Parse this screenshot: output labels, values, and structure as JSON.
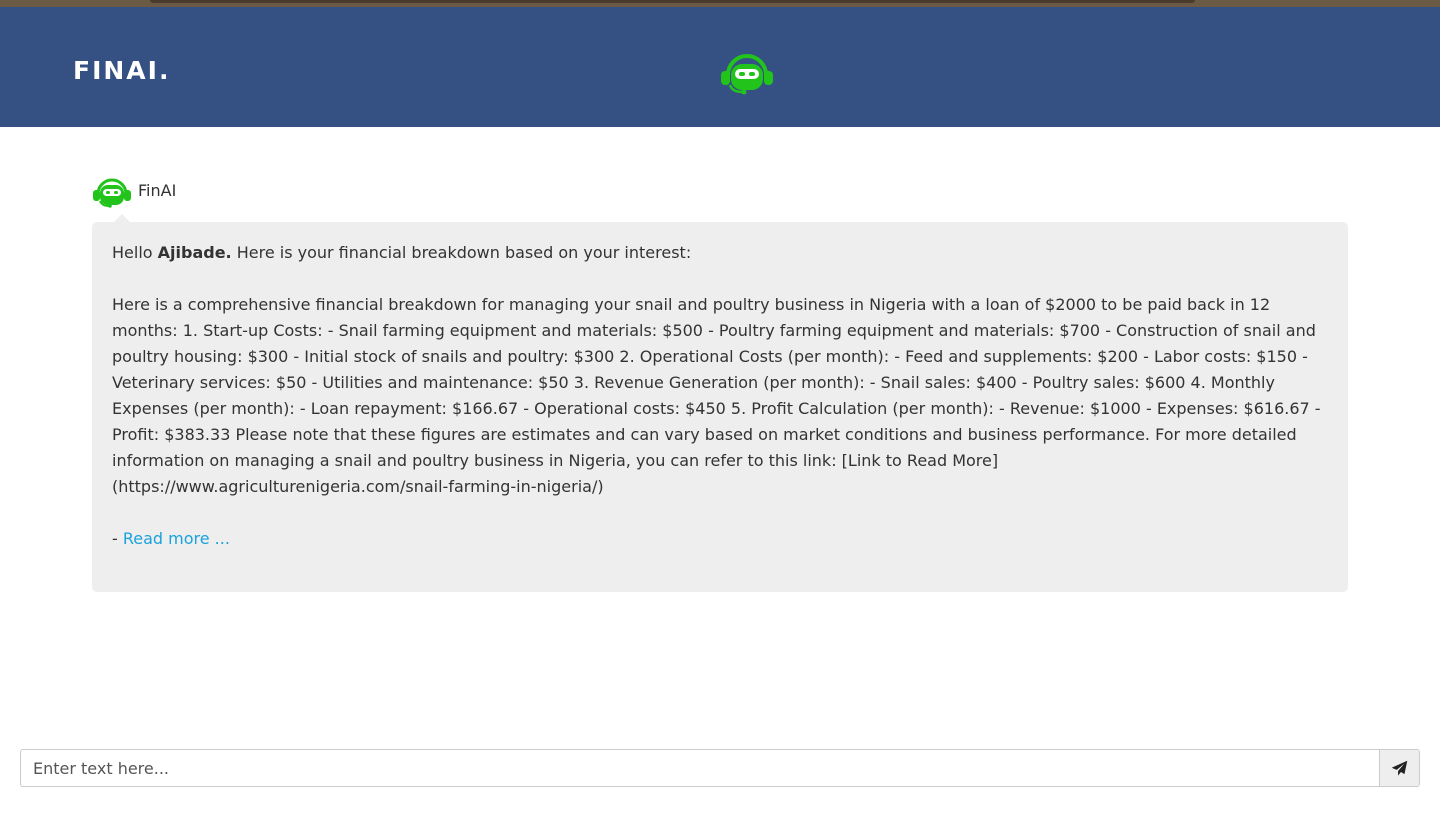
{
  "header": {
    "brand": "FINAI."
  },
  "chat": {
    "messages": [
      {
        "sender": "FinAI",
        "greeting_prefix": "Hello ",
        "user_name": "Ajibade.",
        "greeting_suffix": " Here is your financial breakdown based on your interest:",
        "body": "Here is a comprehensive financial breakdown for managing your snail and poultry business in Nigeria with a loan of $2000 to be paid back in 12 months: 1. Start-up Costs: - Snail farming equipment and materials: $500 - Poultry farming equipment and materials: $700 - Construction of snail and poultry housing: $300 - Initial stock of snails and poultry: $300 2. Operational Costs (per month): - Feed and supplements: $200 - Labor costs: $150 - Veterinary services: $50 - Utilities and maintenance: $50 3. Revenue Generation (per month): - Snail sales: $400 - Poultry sales: $600 4. Monthly Expenses (per month): - Loan repayment: $166.67 - Operational costs: $450 5. Profit Calculation (per month): - Revenue: $1000 - Expenses: $616.67 - Profit: $383.33 Please note that these figures are estimates and can vary based on market conditions and business performance. For more detailed information on managing a snail and poultry business in Nigeria, you can refer to this link: [Link to Read More](https://www.agriculturenigeria.com/snail-farming-in-nigeria/)",
        "read_more_prefix": "- ",
        "read_more_label": "Read more ..."
      }
    ]
  },
  "composer": {
    "placeholder": "Enter text here...",
    "value": ""
  },
  "icons": {
    "brand_bot": "robot-headset-icon",
    "send": "paper-plane-icon"
  },
  "colors": {
    "header_bg": "#355184",
    "bot_green": "#22c41c",
    "bubble_bg": "#eeeeee",
    "link": "#1aa2dc"
  }
}
